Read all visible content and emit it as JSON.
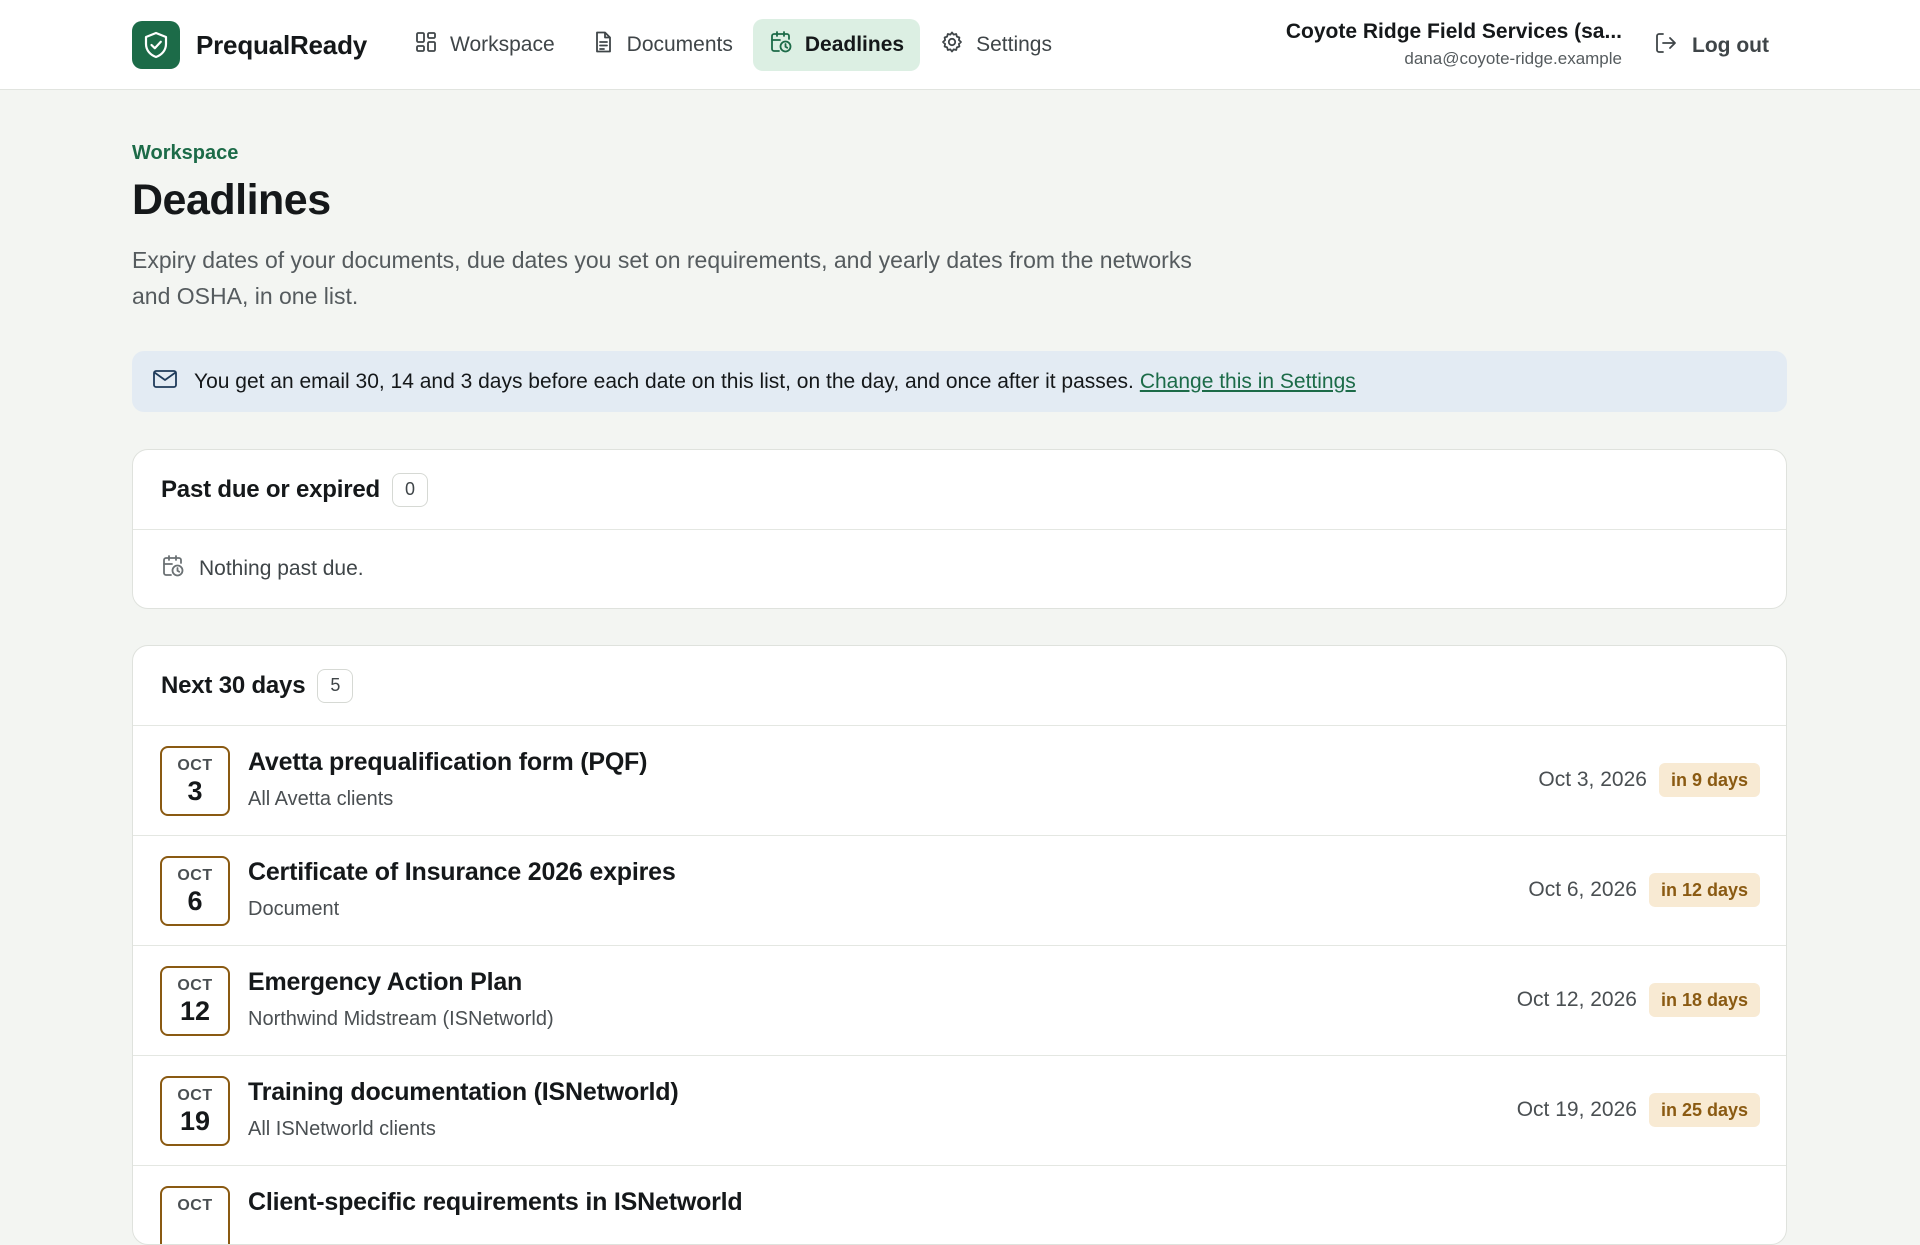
{
  "app": {
    "name": "PrequalReady"
  },
  "nav": {
    "items": [
      {
        "label": "Workspace",
        "icon": "grid-icon"
      },
      {
        "label": "Documents",
        "icon": "document-icon"
      },
      {
        "label": "Deadlines",
        "icon": "calendar-clock-icon",
        "active": true
      },
      {
        "label": "Settings",
        "icon": "gear-icon"
      }
    ]
  },
  "account": {
    "name": "Coyote Ridge Field Services (sa...",
    "email": "dana@coyote-ridge.example",
    "logout_label": "Log out"
  },
  "page": {
    "breadcrumb": "Workspace",
    "title": "Deadlines",
    "subtitle": "Expiry dates of your documents, due dates you set on requirements, and yearly dates from the networks and OSHA, in one list."
  },
  "banner": {
    "text": "You get an email 30, 14 and 3 days before each date on this list, on the day, and once after it passes.",
    "link_label": "Change this in Settings"
  },
  "past_due": {
    "title": "Past due or expired",
    "count": "0",
    "empty_text": "Nothing past due."
  },
  "next30": {
    "title": "Next 30 days",
    "count": "5",
    "items": [
      {
        "month": "OCT",
        "day": "3",
        "title": "Avetta prequalification form (PQF)",
        "subtitle": "All Avetta clients",
        "date": "Oct 3, 2026",
        "due": "in 9 days"
      },
      {
        "month": "OCT",
        "day": "6",
        "title": "Certificate of Insurance 2026 expires",
        "subtitle": "Document",
        "date": "Oct 6, 2026",
        "due": "in 12 days"
      },
      {
        "month": "OCT",
        "day": "12",
        "title": "Emergency Action Plan",
        "subtitle": "Northwind Midstream (ISNetworld)",
        "date": "Oct 12, 2026",
        "due": "in 18 days"
      },
      {
        "month": "OCT",
        "day": "19",
        "title": "Training documentation (ISNetworld)",
        "subtitle": "All ISNetworld clients",
        "date": "Oct 19, 2026",
        "due": "in 25 days"
      },
      {
        "month": "OCT",
        "day": "",
        "title": "Client-specific requirements in ISNetworld",
        "subtitle": "",
        "date": "",
        "due": ""
      }
    ]
  },
  "colors": {
    "brand": "#1c6b48",
    "active_nav_bg": "#dcefe3",
    "banner_bg": "#e3ebf3",
    "due_pill_bg": "#f8ead3",
    "due_pill_text": "#8a5a12",
    "page_bg": "#f3f5f2"
  }
}
